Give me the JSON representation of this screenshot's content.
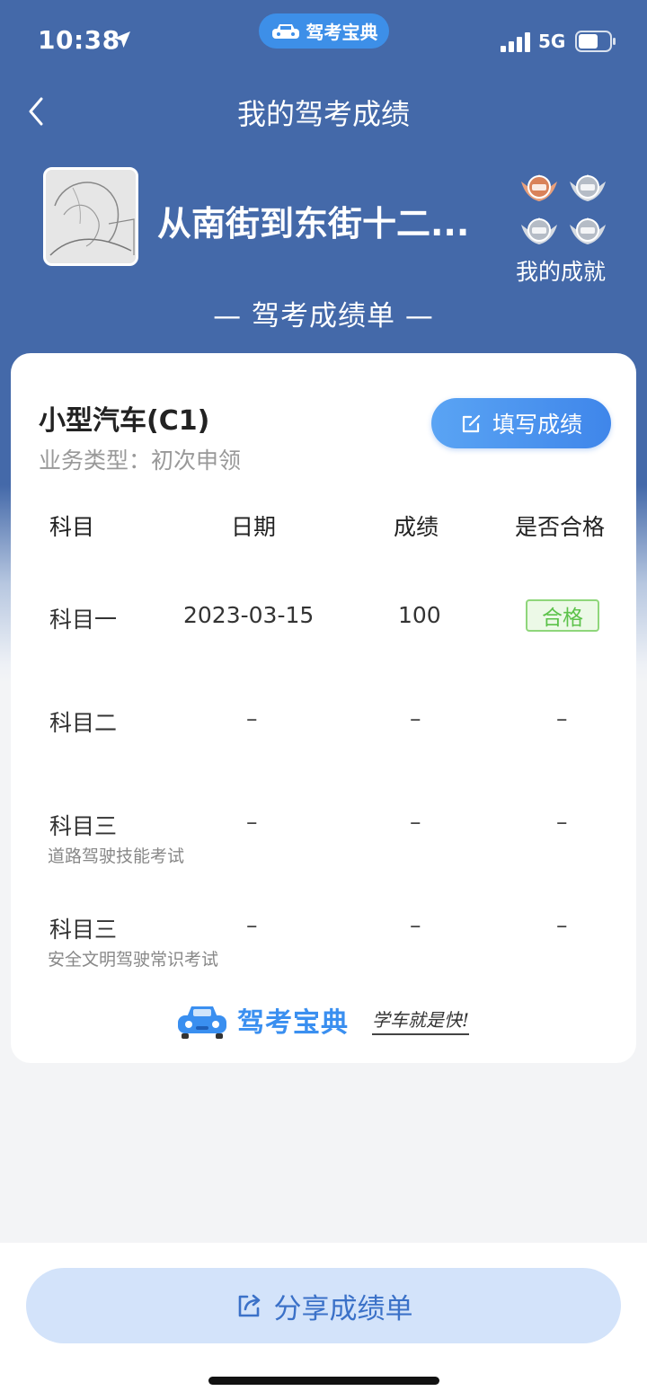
{
  "status": {
    "time": "10:38",
    "network": "5G",
    "app_name": "驾考宝典"
  },
  "header": {
    "title": "我的驾考成绩"
  },
  "profile": {
    "username": "从南街到东街十二...",
    "achievements_label": "我的成就",
    "badges": [
      "bronze-pass-medal",
      "silver-pass-medal",
      "silver-pass-medal",
      "silver-pass-medal"
    ]
  },
  "report": {
    "title": "— 驾考成绩单 —"
  },
  "card": {
    "car_type": "小型汽车(C1)",
    "business_type": "业务类型：初次申领",
    "fill_button": "填写成绩",
    "headers": [
      "科目",
      "日期",
      "成绩",
      "是否合格"
    ],
    "rows": [
      {
        "subject": "科目一",
        "subtitle": "",
        "date": "2023-03-15",
        "score": "100",
        "status": "合格"
      },
      {
        "subject": "科目二",
        "subtitle": "",
        "date": "–",
        "score": "–",
        "status": "–"
      },
      {
        "subject": "科目三",
        "subtitle": "道路驾驶技能考试",
        "date": "–",
        "score": "–",
        "status": "–"
      },
      {
        "subject": "科目三",
        "subtitle": "安全文明驾驶常识考试",
        "date": "–",
        "score": "–",
        "status": "–"
      }
    ],
    "brand_name": "驾考宝典",
    "slogan": "学车就是快!"
  },
  "footer": {
    "share_button": "分享成绩单"
  },
  "colors": {
    "header_bg": "#4469a9",
    "accent": "#3f86ea",
    "pass": "#5cc24a"
  }
}
